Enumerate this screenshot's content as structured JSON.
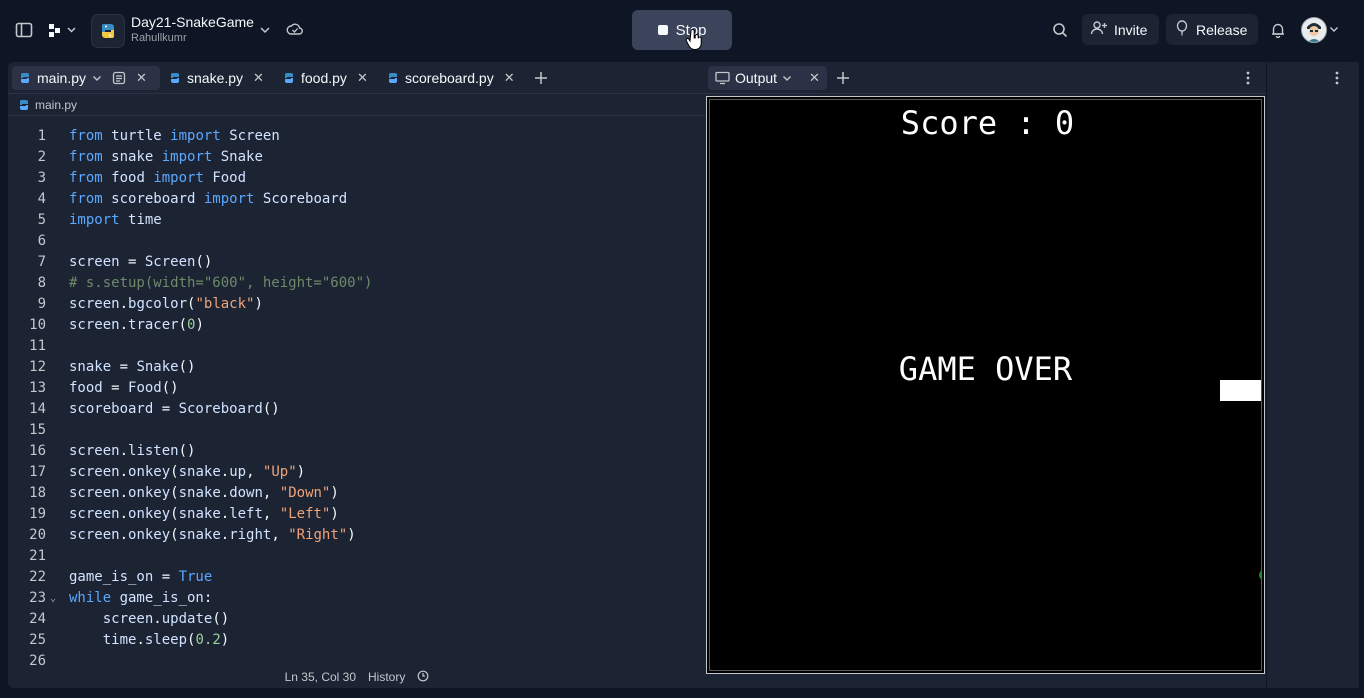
{
  "app": {
    "repl_name": "Day21-SnakeGame",
    "owner": "Rahullkumr",
    "run_button": "Stop",
    "invite": "Invite",
    "release": "Release"
  },
  "tabs": [
    {
      "label": "main.py"
    },
    {
      "label": "snake.py"
    },
    {
      "label": "food.py"
    },
    {
      "label": "scoreboard.py"
    }
  ],
  "breadcrumb": "main.py",
  "output": {
    "tab_label": "Output",
    "score_text": "Score : 0",
    "game_over_text": "GAME OVER"
  },
  "code": {
    "line_numbers": [
      "1",
      "2",
      "3",
      "4",
      "5",
      "6",
      "7",
      "8",
      "9",
      "10",
      "11",
      "12",
      "13",
      "14",
      "15",
      "16",
      "17",
      "18",
      "19",
      "20",
      "21",
      "22",
      "23",
      "24",
      "25",
      "26"
    ],
    "lines": [
      [
        [
          "kw",
          "from "
        ],
        [
          "id",
          "turtle "
        ],
        [
          "kw",
          "import "
        ],
        [
          "id",
          "Screen"
        ]
      ],
      [
        [
          "kw",
          "from "
        ],
        [
          "id",
          "snake "
        ],
        [
          "kw",
          "import "
        ],
        [
          "id",
          "Snake"
        ]
      ],
      [
        [
          "kw",
          "from "
        ],
        [
          "id",
          "food "
        ],
        [
          "kw",
          "import "
        ],
        [
          "id",
          "Food"
        ]
      ],
      [
        [
          "kw",
          "from "
        ],
        [
          "id",
          "scoreboard "
        ],
        [
          "kw",
          "import "
        ],
        [
          "id",
          "Scoreboard"
        ]
      ],
      [
        [
          "kw",
          "import "
        ],
        [
          "id",
          "time"
        ]
      ],
      [],
      [
        [
          "id",
          "screen "
        ],
        [
          "pl",
          "= "
        ],
        [
          "fn",
          "Screen"
        ],
        [
          "pl",
          "()"
        ]
      ],
      [
        [
          "cmt",
          "# s.setup(width=\"600\", height=\"600\")"
        ]
      ],
      [
        [
          "id",
          "screen"
        ],
        [
          "pl",
          "."
        ],
        [
          "fn",
          "bgcolor"
        ],
        [
          "pl",
          "("
        ],
        [
          "str",
          "\"black\""
        ],
        [
          "pl",
          ")"
        ]
      ],
      [
        [
          "id",
          "screen"
        ],
        [
          "pl",
          "."
        ],
        [
          "fn",
          "tracer"
        ],
        [
          "pl",
          "("
        ],
        [
          "num",
          "0"
        ],
        [
          "pl",
          ")"
        ]
      ],
      [],
      [
        [
          "id",
          "snake "
        ],
        [
          "pl",
          "= "
        ],
        [
          "fn",
          "Snake"
        ],
        [
          "pl",
          "()"
        ]
      ],
      [
        [
          "id",
          "food "
        ],
        [
          "pl",
          "= "
        ],
        [
          "fn",
          "Food"
        ],
        [
          "pl",
          "()"
        ]
      ],
      [
        [
          "id",
          "scoreboard "
        ],
        [
          "pl",
          "= "
        ],
        [
          "fn",
          "Scoreboard"
        ],
        [
          "pl",
          "()"
        ]
      ],
      [],
      [
        [
          "id",
          "screen"
        ],
        [
          "pl",
          "."
        ],
        [
          "fn",
          "listen"
        ],
        [
          "pl",
          "()"
        ]
      ],
      [
        [
          "id",
          "screen"
        ],
        [
          "pl",
          "."
        ],
        [
          "fn",
          "onkey"
        ],
        [
          "pl",
          "("
        ],
        [
          "id",
          "snake"
        ],
        [
          "pl",
          "."
        ],
        [
          "id",
          "up"
        ],
        [
          "pl",
          ", "
        ],
        [
          "str",
          "\"Up\""
        ],
        [
          "pl",
          ")"
        ]
      ],
      [
        [
          "id",
          "screen"
        ],
        [
          "pl",
          "."
        ],
        [
          "fn",
          "onkey"
        ],
        [
          "pl",
          "("
        ],
        [
          "id",
          "snake"
        ],
        [
          "pl",
          "."
        ],
        [
          "id",
          "down"
        ],
        [
          "pl",
          ", "
        ],
        [
          "str",
          "\"Down\""
        ],
        [
          "pl",
          ")"
        ]
      ],
      [
        [
          "id",
          "screen"
        ],
        [
          "pl",
          "."
        ],
        [
          "fn",
          "onkey"
        ],
        [
          "pl",
          "("
        ],
        [
          "id",
          "snake"
        ],
        [
          "pl",
          "."
        ],
        [
          "id",
          "left"
        ],
        [
          "pl",
          ", "
        ],
        [
          "str",
          "\"Left\""
        ],
        [
          "pl",
          ")"
        ]
      ],
      [
        [
          "id",
          "screen"
        ],
        [
          "pl",
          "."
        ],
        [
          "fn",
          "onkey"
        ],
        [
          "pl",
          "("
        ],
        [
          "id",
          "snake"
        ],
        [
          "pl",
          "."
        ],
        [
          "id",
          "right"
        ],
        [
          "pl",
          ", "
        ],
        [
          "str",
          "\"Right\""
        ],
        [
          "pl",
          ")"
        ]
      ],
      [],
      [
        [
          "id",
          "game_is_on "
        ],
        [
          "pl",
          "= "
        ],
        [
          "boo",
          "True"
        ]
      ],
      [
        [
          "kw",
          "while "
        ],
        [
          "id",
          "game_is_on"
        ],
        [
          "pl",
          ":"
        ]
      ],
      [
        [
          "pl",
          "    "
        ],
        [
          "id",
          "screen"
        ],
        [
          "pl",
          "."
        ],
        [
          "fn",
          "update"
        ],
        [
          "pl",
          "()"
        ]
      ],
      [
        [
          "pl",
          "    "
        ],
        [
          "id",
          "time"
        ],
        [
          "pl",
          "."
        ],
        [
          "fn",
          "sleep"
        ],
        [
          "pl",
          "("
        ],
        [
          "num",
          "0.2"
        ],
        [
          "pl",
          ")"
        ]
      ],
      []
    ]
  },
  "status": {
    "cursor": "Ln 35, Col 30",
    "history": "History"
  },
  "colors": {
    "background": "#0e1525",
    "panel": "#1c2333",
    "keyword": "#5ba8ff",
    "string": "#f0a378",
    "number": "#9cd19b",
    "comment": "#6d8a6a",
    "food": "#1e8a2a"
  },
  "icons": {
    "sidebar_toggle": "sidebar-icon",
    "apps": "apps-icon",
    "cloud": "cloud-icon",
    "search": "search-icon",
    "invite": "person-add-icon",
    "release": "balloon-icon",
    "bell": "bell-icon",
    "menu": "kebab-icon"
  }
}
